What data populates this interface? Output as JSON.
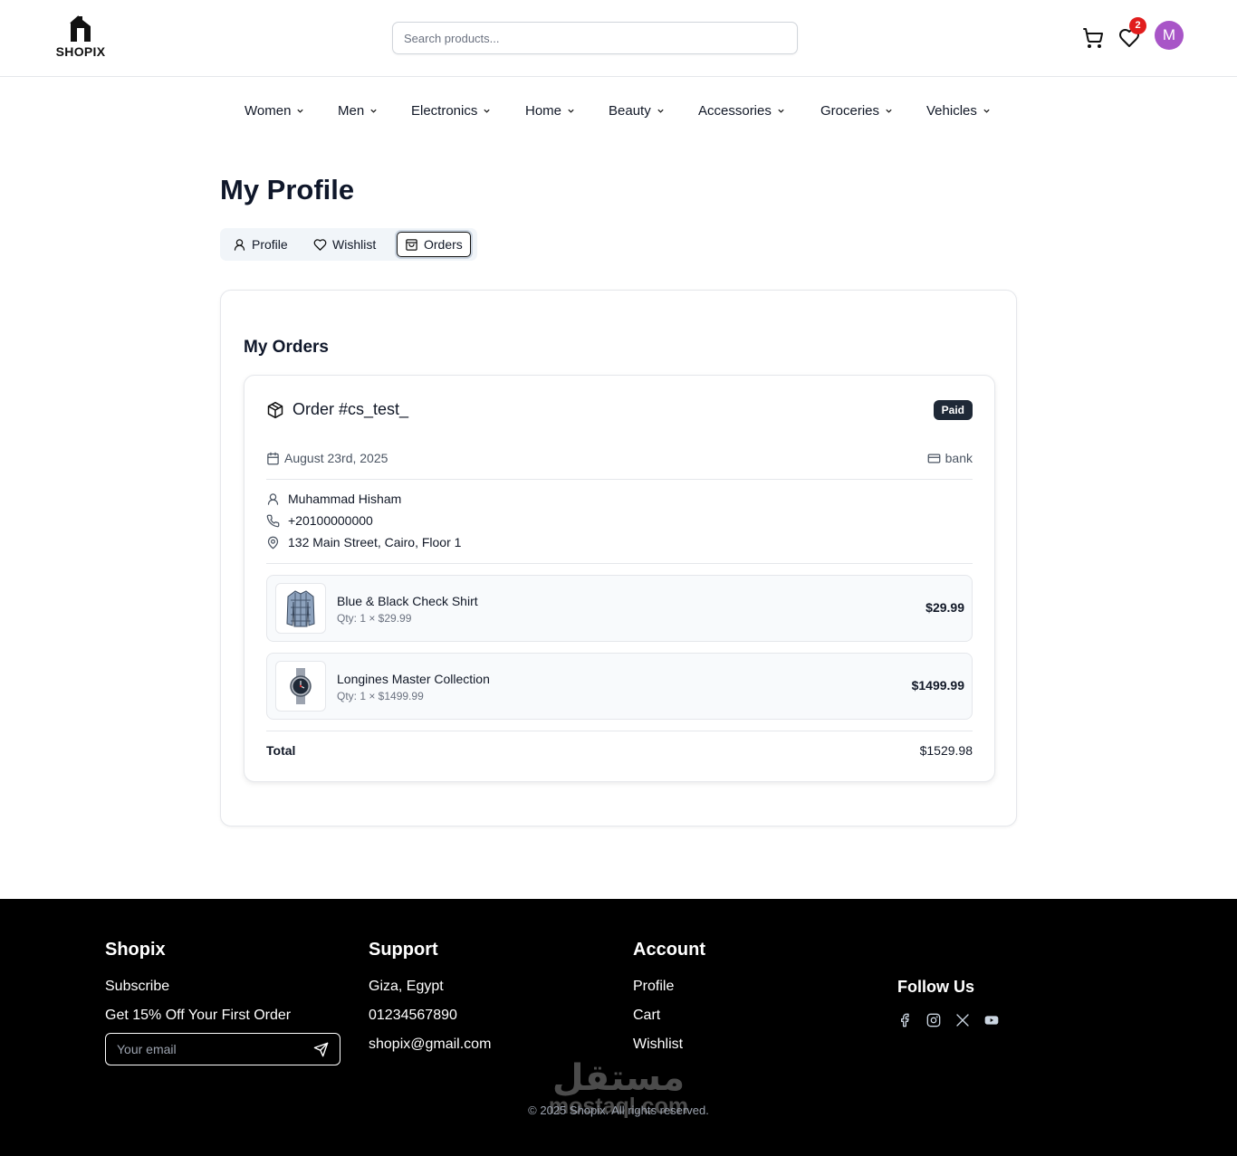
{
  "header": {
    "logo_text": "SHOPIX",
    "search_placeholder": "Search products...",
    "wishlist_count": "2",
    "avatar_initial": "M",
    "avatar_color": "#a855c7"
  },
  "categories": [
    "Women",
    "Men",
    "Electronics",
    "Home",
    "Beauty",
    "Accessories",
    "Groceries",
    "Vehicles"
  ],
  "page": {
    "title": "My Profile",
    "tabs": [
      {
        "label": "Profile",
        "icon": "user-icon"
      },
      {
        "label": "Wishlist",
        "icon": "heart-icon"
      },
      {
        "label": "Orders",
        "icon": "shopping-bag-icon",
        "active": true
      }
    ]
  },
  "orders": {
    "section_title": "My Orders",
    "order": {
      "id": "Order #cs_test_",
      "status": "Paid",
      "date": "August 23rd, 2025",
      "payment": "bank",
      "customer_name": "Muhammad Hisham",
      "phone": "+20100000000",
      "address": "132 Main Street, Cairo, Floor 1",
      "items": [
        {
          "name": "Blue & Black Check Shirt",
          "qty": "Qty: 1 × $29.99",
          "price": "$29.99"
        },
        {
          "name": "Longines Master Collection",
          "qty": "Qty: 1 × $1499.99",
          "price": "$1499.99"
        }
      ],
      "total_label": "Total",
      "total_value": "$1529.98"
    }
  },
  "footer": {
    "brand": "Shopix",
    "subscribe": "Subscribe",
    "offer": "Get 15% Off Your First Order",
    "email_placeholder": "Your email",
    "support_title": "Support",
    "support_lines": [
      "Giza, Egypt",
      "01234567890",
      "shopix@gmail.com"
    ],
    "account_title": "Account",
    "account_links": [
      "Profile",
      "Cart",
      "Wishlist"
    ],
    "follow_title": "Follow Us",
    "social_icons": [
      "facebook-icon",
      "instagram-icon",
      "x-icon",
      "youtube-icon"
    ],
    "copyright": "© 2025 Shopix. All rights reserved.",
    "watermark_ar": "مستقل",
    "watermark_en": "mostaql.com"
  }
}
